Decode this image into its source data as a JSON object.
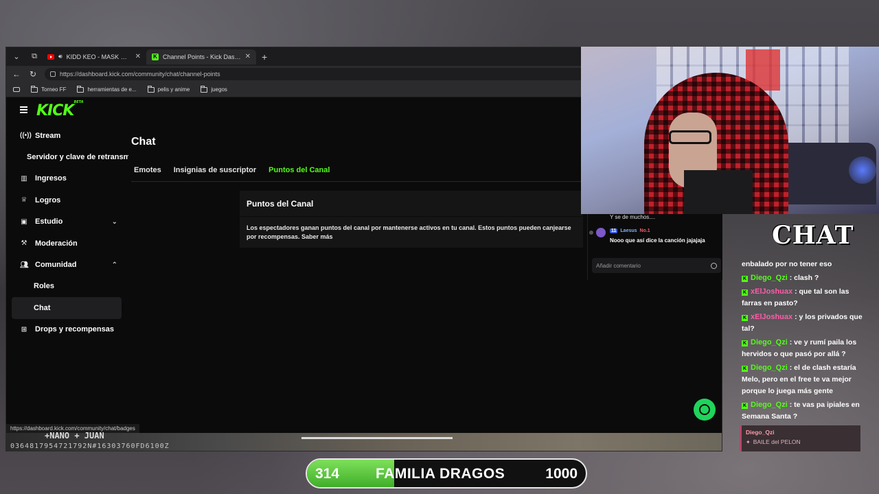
{
  "browser": {
    "tabs": [
      {
        "title": "KIDD KEO - MASK OFF (REM",
        "favicon": "youtube-icon",
        "audio": true,
        "active": false
      },
      {
        "title": "Channel Points - Kick Dashboard",
        "favicon": "kick-icon",
        "active": true
      }
    ],
    "url": "https://dashboard.kick.com/community/chat/channel-points",
    "bookmarks": [
      "Torneo FF",
      "herramientas de e...",
      "pelis y anime",
      "juegos"
    ],
    "status_url": "https://dashboard.kick.com/community/chat/badges"
  },
  "dashboard": {
    "logo_text": "KICK",
    "logo_badge": "BETA",
    "sidebar": [
      {
        "label": "Stream",
        "icon": "broadcast-icon"
      },
      {
        "label": "Servidor y clave de retransm",
        "sub": true
      },
      {
        "label": "Ingresos",
        "icon": "chart-icon"
      },
      {
        "label": "Logros",
        "icon": "trophy-icon"
      },
      {
        "label": "Estudio",
        "icon": "studio-icon",
        "chevron": "down"
      },
      {
        "label": "Moderación",
        "icon": "hammer-icon"
      },
      {
        "label": "Comunidad",
        "icon": "people-icon",
        "chevron": "up"
      },
      {
        "label": "Roles",
        "sub": true
      },
      {
        "label": "Chat",
        "sub": true,
        "active": true
      },
      {
        "label": "Drops y recompensas",
        "icon": "gift-icon"
      }
    ],
    "page_title": "Chat",
    "tabs": [
      "Emotes",
      "Insignias de suscriptor",
      "Puntos del Canal"
    ],
    "active_tab": "Puntos del Canal",
    "card_title": "Puntos del Canal",
    "card_body": "Los espectadores ganan puntos del canal por mantenerse activos en tu canal. Estos puntos pueden canjearse por recompensas. Saber más"
  },
  "game_strip": {
    "line1": "+NANO  + JUAN",
    "line2": "0364817954721792N#16303760FD6100Z"
  },
  "overlay_chat": {
    "prev_message": "Y se de muchos....",
    "badge_count": "11",
    "username": "Laesus",
    "rank_badge": "No.1",
    "message": "Nooo que así dice la canción jajajaja",
    "input_placeholder": "Añadir comentario"
  },
  "stream_chat": {
    "title": "CHAT",
    "messages": [
      {
        "user": "",
        "text": "enbalado por no tener eso"
      },
      {
        "user": "Diego_Qzi",
        "color": "green",
        "text": ": clash ?"
      },
      {
        "user": "xElJoshuax",
        "color": "pink",
        "text": ": que tal son las farras en pasto?"
      },
      {
        "user": "xElJoshuax",
        "color": "pink",
        "text": ": y los privados que tal?"
      },
      {
        "user": "Diego_Qzi",
        "color": "green",
        "text": ": ve y rumí paila los hervidos o que pasó por allá ?"
      },
      {
        "user": "Diego_Qzi",
        "color": "green",
        "text": ": el de clash estaría Melo, pero en el free te va mejor porque lo juega más gente"
      },
      {
        "user": "Diego_Qzi",
        "color": "green",
        "text": ": te vas pa ipiales en Semana Santa ?"
      }
    ],
    "alert": {
      "user": "Diego_Qzi",
      "text": "BAILE del PELON"
    }
  },
  "goal": {
    "current": "314",
    "label": "FAMILIA DRAGOS",
    "target": "1000",
    "progress": 0.314,
    "color": "#53fc18"
  }
}
